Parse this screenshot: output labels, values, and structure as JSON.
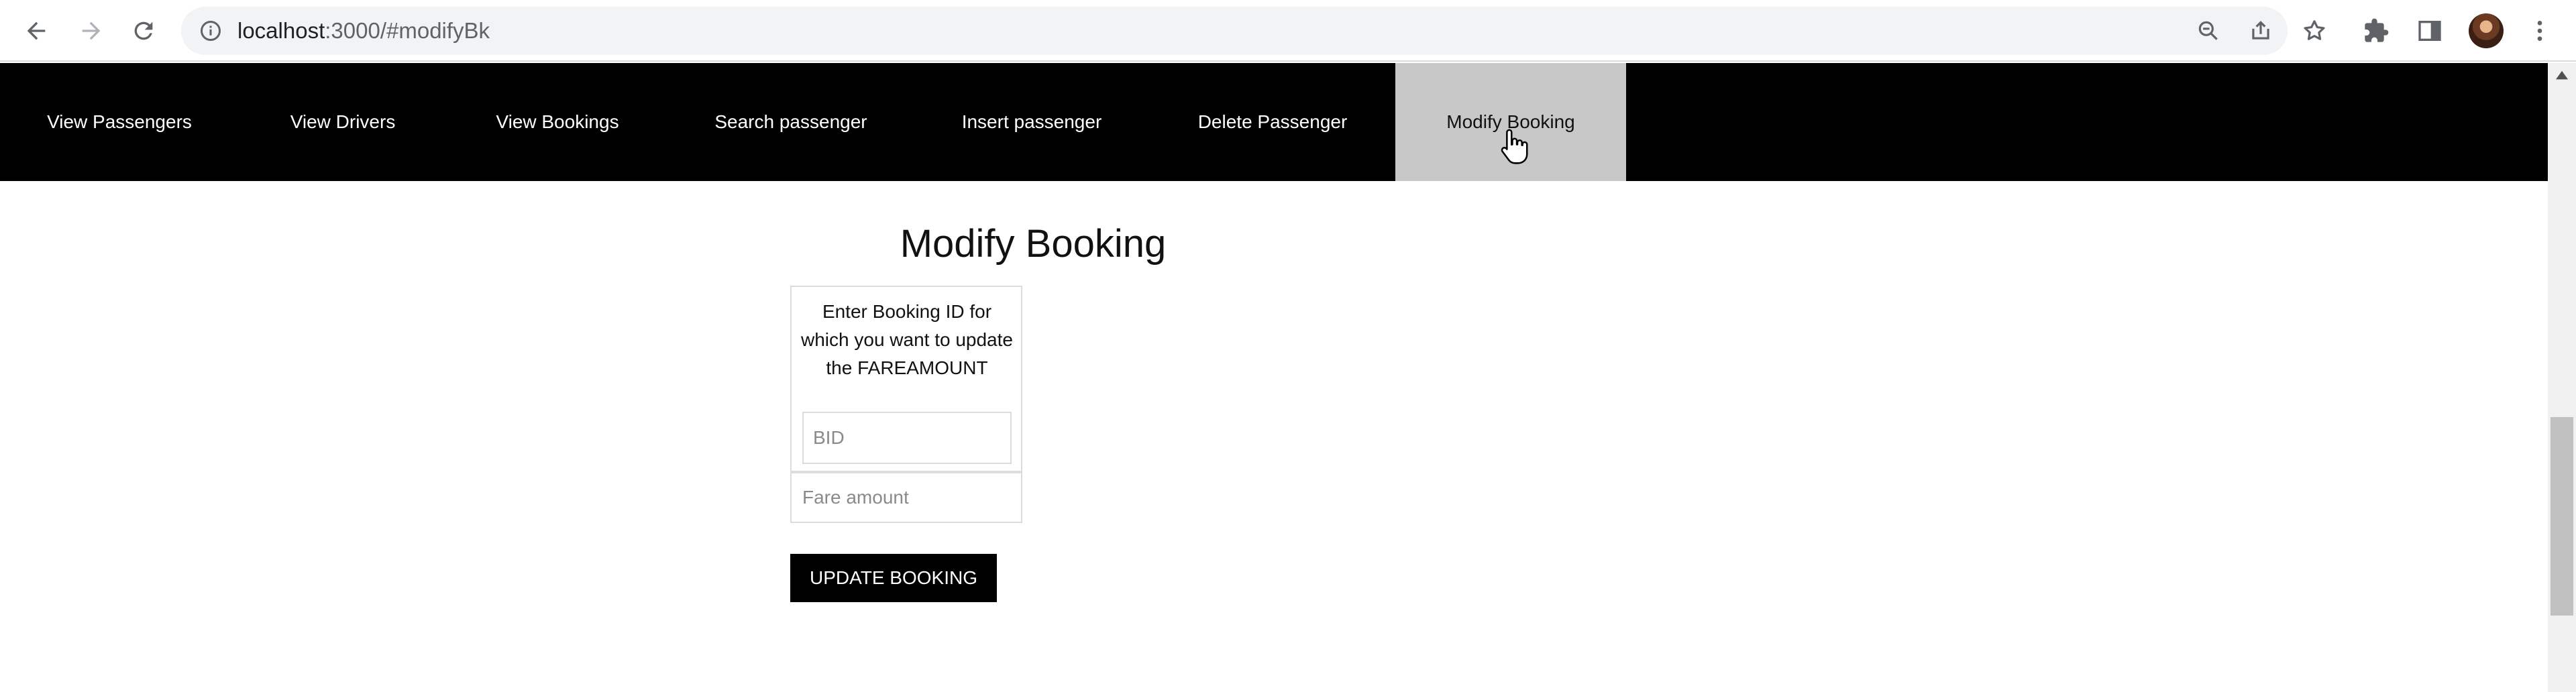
{
  "browser": {
    "url_host": "localhost",
    "url_path": ":3000/#modifyBk",
    "icons": {
      "back": "arrow-left-icon",
      "forward": "arrow-right-icon",
      "reload": "reload-icon",
      "site_info": "info-icon",
      "zoom": "zoom-out-icon",
      "share": "share-icon",
      "bookmark": "star-icon",
      "extensions": "puzzle-icon",
      "side_panel": "side-panel-icon",
      "profile": "avatar",
      "menu": "kebab-menu-icon"
    }
  },
  "nav": {
    "items": [
      {
        "label": "View Passengers"
      },
      {
        "label": "View Drivers"
      },
      {
        "label": "View Bookings"
      },
      {
        "label": "Search passenger"
      },
      {
        "label": "Insert passenger"
      },
      {
        "label": "Delete Passenger"
      },
      {
        "label": "Modify Booking"
      }
    ],
    "active_index": 6
  },
  "main": {
    "title": "Modify Booking",
    "prompt": "Enter Booking ID for which you want to update the FAREAMOUNT",
    "bid_input": {
      "value": "",
      "placeholder": "BID"
    },
    "fare_input": {
      "value": "",
      "placeholder": "Fare amount"
    },
    "submit_label": "UPDATE BOOKING"
  },
  "colors": {
    "nav_bg": "#000000",
    "nav_active_bg": "#c8c8c8",
    "button_bg": "#000000",
    "button_text": "#ffffff"
  }
}
